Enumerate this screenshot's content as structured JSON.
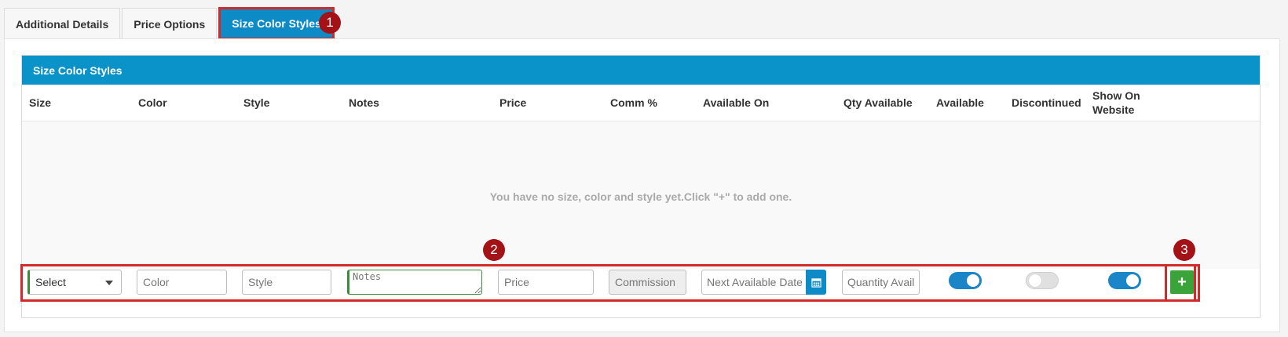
{
  "tabs": [
    {
      "label": "Additional Details"
    },
    {
      "label": "Price Options"
    },
    {
      "label": "Size Color Styles",
      "active": true
    }
  ],
  "badges": [
    "1",
    "2",
    "3"
  ],
  "panel": {
    "title": "Size Color Styles",
    "columns": [
      "Size",
      "Color",
      "Style",
      "Notes",
      "Price",
      "Comm %",
      "Available On",
      "Qty Available",
      "Available",
      "Discontinued",
      "Show On Website"
    ],
    "empty_message": "You have no size, color and style yet.Click \"+\" to add one."
  },
  "form": {
    "size_select_value": "Select",
    "color_placeholder": "Color",
    "style_placeholder": "Style",
    "notes_placeholder": "Notes",
    "price_placeholder": "Price",
    "commission_placeholder": "Commission",
    "next_date_placeholder": "Next Available Date",
    "quantity_placeholder": "Quantity Available",
    "available": true,
    "discontinued": false,
    "show_on_website": true,
    "add_label": "+"
  },
  "colors": {
    "primary": "#0993c8",
    "highlight": "#d22a2a",
    "badge": "#a21217",
    "add": "#3aa33a"
  }
}
